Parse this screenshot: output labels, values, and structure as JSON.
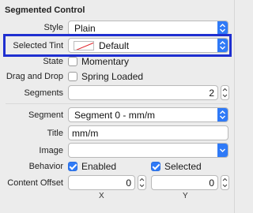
{
  "section_title": "Segmented Control",
  "style": {
    "label": "Style",
    "value": "Plain"
  },
  "selected_tint": {
    "label": "Selected Tint",
    "value": "Default"
  },
  "state": {
    "label": "State",
    "option": "Momentary",
    "checked": false
  },
  "drag_and_drop": {
    "label": "Drag and Drop",
    "option": "Spring Loaded",
    "checked": false
  },
  "segments": {
    "label": "Segments",
    "value": "2"
  },
  "segment": {
    "label": "Segment",
    "value": "Segment 0 - mm/m"
  },
  "title": {
    "label": "Title",
    "value": "mm/m"
  },
  "image": {
    "label": "Image",
    "value": ""
  },
  "behavior": {
    "label": "Behavior",
    "enabled": {
      "label": "Enabled",
      "checked": true
    },
    "selected": {
      "label": "Selected",
      "checked": true
    }
  },
  "content_offset": {
    "label": "Content Offset",
    "x": "0",
    "y": "0",
    "x_label": "X",
    "y_label": "Y"
  },
  "colors": {
    "accent": "#2f7af7",
    "highlight_border": "#1f2fd0"
  }
}
